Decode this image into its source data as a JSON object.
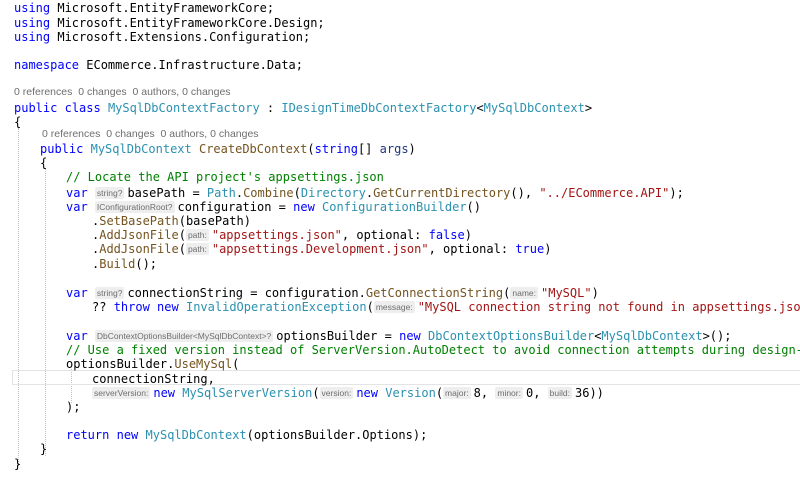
{
  "editor": {
    "language": "csharp",
    "colors": {
      "keyword": "#0000ff",
      "type": "#2b91af",
      "method": "#74531f",
      "string": "#a31515",
      "comment": "#008000",
      "parameter": "#1f377f",
      "plain": "#000000",
      "codelens": "#6e6e6e",
      "hint_text": "#6e6e6e",
      "hint_background": "#eeeeee"
    },
    "lines": [
      {
        "kind": "code",
        "tokens": [
          {
            "t": "using",
            "c": "kw"
          },
          {
            "t": " Microsoft.EntityFrameworkCore;",
            "c": "pl"
          }
        ]
      },
      {
        "kind": "code",
        "tokens": [
          {
            "t": "using",
            "c": "kw"
          },
          {
            "t": " Microsoft.EntityFrameworkCore.Design;",
            "c": "pl"
          }
        ]
      },
      {
        "kind": "code",
        "tokens": [
          {
            "t": "using",
            "c": "kw"
          },
          {
            "t": " Microsoft.Extensions.Configuration;",
            "c": "pl"
          }
        ]
      },
      {
        "kind": "blank",
        "tokens": []
      },
      {
        "kind": "code",
        "tokens": [
          {
            "t": "namespace",
            "c": "kw"
          },
          {
            "t": " ECommerce.Infrastructure.Data;",
            "c": "pl"
          }
        ]
      },
      {
        "kind": "blank",
        "tokens": []
      },
      {
        "kind": "lens",
        "tokens": [
          {
            "t": "0 references  0 changes  0 authors, 0 changes",
            "c": "lens"
          }
        ]
      },
      {
        "kind": "code",
        "tokens": [
          {
            "t": "public",
            "c": "kw"
          },
          {
            "t": " ",
            "c": "pl"
          },
          {
            "t": "class",
            "c": "kw"
          },
          {
            "t": " ",
            "c": "pl"
          },
          {
            "t": "MySqlDbContextFactory",
            "c": "ty"
          },
          {
            "t": " : ",
            "c": "pl"
          },
          {
            "t": "IDesignTimeDbContextFactory",
            "c": "ty"
          },
          {
            "t": "<",
            "c": "pl"
          },
          {
            "t": "MySqlDbContext",
            "c": "ty"
          },
          {
            "t": ">",
            "c": "pl"
          }
        ]
      },
      {
        "kind": "code",
        "tokens": [
          {
            "t": "{",
            "c": "pl"
          }
        ]
      },
      {
        "kind": "lens",
        "tokens": [
          {
            "t": "0 references  0 changes  0 authors, 0 changes",
            "c": "lens"
          }
        ]
      },
      {
        "kind": "code",
        "tokens": [
          {
            "t": "public",
            "c": "kw"
          },
          {
            "t": " ",
            "c": "pl"
          },
          {
            "t": "MySqlDbContext",
            "c": "ty"
          },
          {
            "t": " ",
            "c": "pl"
          },
          {
            "t": "CreateDbContext",
            "c": "mt"
          },
          {
            "t": "(",
            "c": "pl"
          },
          {
            "t": "string",
            "c": "kw"
          },
          {
            "t": "[] ",
            "c": "pl"
          },
          {
            "t": "args",
            "c": "pr"
          },
          {
            "t": ")",
            "c": "pl"
          }
        ]
      },
      {
        "kind": "code",
        "tokens": [
          {
            "t": "{",
            "c": "pl"
          }
        ]
      },
      {
        "kind": "code",
        "tokens": [
          {
            "t": "// Locate the API project's appsettings.json",
            "c": "cm"
          }
        ]
      },
      {
        "kind": "code",
        "tokens": [
          {
            "t": "var",
            "c": "kw"
          },
          {
            "t": " ",
            "c": "pl"
          },
          {
            "t": "string?",
            "c": "hint"
          },
          {
            "t": "basePath = ",
            "c": "pl"
          },
          {
            "t": "Path",
            "c": "ty"
          },
          {
            "t": ".",
            "c": "pl"
          },
          {
            "t": "Combine",
            "c": "mt"
          },
          {
            "t": "(",
            "c": "pl"
          },
          {
            "t": "Directory",
            "c": "ty"
          },
          {
            "t": ".",
            "c": "pl"
          },
          {
            "t": "GetCurrentDirectory",
            "c": "mt"
          },
          {
            "t": "(), ",
            "c": "pl"
          },
          {
            "t": "\"../ECommerce.API\"",
            "c": "st"
          },
          {
            "t": ");",
            "c": "pl"
          }
        ]
      },
      {
        "kind": "code",
        "tokens": [
          {
            "t": "var",
            "c": "kw"
          },
          {
            "t": " ",
            "c": "pl"
          },
          {
            "t": "IConfigurationRoot?",
            "c": "hint"
          },
          {
            "t": "configuration = ",
            "c": "pl"
          },
          {
            "t": "new",
            "c": "kw"
          },
          {
            "t": " ",
            "c": "pl"
          },
          {
            "t": "ConfigurationBuilder",
            "c": "ty"
          },
          {
            "t": "()",
            "c": "pl"
          }
        ]
      },
      {
        "kind": "code",
        "tokens": [
          {
            "t": ".",
            "c": "pl"
          },
          {
            "t": "SetBasePath",
            "c": "mt"
          },
          {
            "t": "(basePath)",
            "c": "pl"
          }
        ]
      },
      {
        "kind": "code",
        "tokens": [
          {
            "t": ".",
            "c": "pl"
          },
          {
            "t": "AddJsonFile",
            "c": "mt"
          },
          {
            "t": "(",
            "c": "pl"
          },
          {
            "t": "path:",
            "c": "hint"
          },
          {
            "t": "\"appsettings.json\"",
            "c": "st"
          },
          {
            "t": ", optional: ",
            "c": "pl"
          },
          {
            "t": "false",
            "c": "kw"
          },
          {
            "t": ")",
            "c": "pl"
          }
        ]
      },
      {
        "kind": "code",
        "tokens": [
          {
            "t": ".",
            "c": "pl"
          },
          {
            "t": "AddJsonFile",
            "c": "mt"
          },
          {
            "t": "(",
            "c": "pl"
          },
          {
            "t": "path:",
            "c": "hint"
          },
          {
            "t": "\"appsettings.Development.json\"",
            "c": "st"
          },
          {
            "t": ", optional: ",
            "c": "pl"
          },
          {
            "t": "true",
            "c": "kw"
          },
          {
            "t": ")",
            "c": "pl"
          }
        ]
      },
      {
        "kind": "code",
        "tokens": [
          {
            "t": ".",
            "c": "pl"
          },
          {
            "t": "Build",
            "c": "mt"
          },
          {
            "t": "();",
            "c": "pl"
          }
        ]
      },
      {
        "kind": "blank",
        "tokens": []
      },
      {
        "kind": "code",
        "tokens": [
          {
            "t": "var",
            "c": "kw"
          },
          {
            "t": " ",
            "c": "pl"
          },
          {
            "t": "string?",
            "c": "hint"
          },
          {
            "t": "connectionString = configuration.",
            "c": "pl"
          },
          {
            "t": "GetConnectionString",
            "c": "mt"
          },
          {
            "t": "(",
            "c": "pl"
          },
          {
            "t": "name:",
            "c": "hint"
          },
          {
            "t": "\"MySQL\"",
            "c": "st"
          },
          {
            "t": ")",
            "c": "pl"
          }
        ]
      },
      {
        "kind": "code",
        "tokens": [
          {
            "t": "?? ",
            "c": "pl"
          },
          {
            "t": "throw",
            "c": "kw"
          },
          {
            "t": " ",
            "c": "pl"
          },
          {
            "t": "new",
            "c": "kw"
          },
          {
            "t": " ",
            "c": "pl"
          },
          {
            "t": "InvalidOperationException",
            "c": "ty"
          },
          {
            "t": "(",
            "c": "pl"
          },
          {
            "t": "message:",
            "c": "hint"
          },
          {
            "t": "\"MySQL connection string not found in appsettings.json\"",
            "c": "st"
          },
          {
            "t": ");",
            "c": "pl"
          }
        ]
      },
      {
        "kind": "blank",
        "tokens": []
      },
      {
        "kind": "code",
        "tokens": [
          {
            "t": "var",
            "c": "kw"
          },
          {
            "t": " ",
            "c": "pl"
          },
          {
            "t": "DbContextOptionsBuilder<MySqlDbContext>?",
            "c": "hint"
          },
          {
            "t": "optionsBuilder = ",
            "c": "pl"
          },
          {
            "t": "new",
            "c": "kw"
          },
          {
            "t": " ",
            "c": "pl"
          },
          {
            "t": "DbContextOptionsBuilder",
            "c": "ty"
          },
          {
            "t": "<",
            "c": "pl"
          },
          {
            "t": "MySqlDbContext",
            "c": "ty"
          },
          {
            "t": ">();",
            "c": "pl"
          }
        ]
      },
      {
        "kind": "code",
        "tokens": [
          {
            "t": "// Use a fixed version instead of ServerVersion.AutoDetect to avoid connection attempts during design-time",
            "c": "cm"
          }
        ]
      },
      {
        "kind": "code",
        "tokens": [
          {
            "t": "optionsBuilder.",
            "c": "pl"
          },
          {
            "t": "UseMySql",
            "c": "mt"
          },
          {
            "t": "(",
            "c": "pl"
          }
        ]
      },
      {
        "kind": "code",
        "tokens": [
          {
            "t": "connectionString,",
            "c": "pl"
          }
        ]
      },
      {
        "kind": "code",
        "tokens": [
          {
            "t": "serverVersion:",
            "c": "hint"
          },
          {
            "t": "new",
            "c": "kw"
          },
          {
            "t": " ",
            "c": "pl"
          },
          {
            "t": "MySqlServerVersion",
            "c": "ty"
          },
          {
            "t": "(",
            "c": "pl"
          },
          {
            "t": "version:",
            "c": "hint"
          },
          {
            "t": "new",
            "c": "kw"
          },
          {
            "t": " ",
            "c": "pl"
          },
          {
            "t": "Version",
            "c": "ty"
          },
          {
            "t": "(",
            "c": "pl"
          },
          {
            "t": "major:",
            "c": "hint"
          },
          {
            "t": "8",
            "c": "nu"
          },
          {
            "t": ", ",
            "c": "pl"
          },
          {
            "t": "minor:",
            "c": "hint"
          },
          {
            "t": "0",
            "c": "nu"
          },
          {
            "t": ", ",
            "c": "pl"
          },
          {
            "t": "build:",
            "c": "hint"
          },
          {
            "t": "36",
            "c": "nu"
          },
          {
            "t": "))",
            "c": "pl"
          }
        ]
      },
      {
        "kind": "code",
        "tokens": [
          {
            "t": ");",
            "c": "pl"
          }
        ]
      },
      {
        "kind": "blank",
        "tokens": []
      },
      {
        "kind": "code",
        "tokens": [
          {
            "t": "return",
            "c": "kw"
          },
          {
            "t": " ",
            "c": "pl"
          },
          {
            "t": "new",
            "c": "kw"
          },
          {
            "t": " ",
            "c": "pl"
          },
          {
            "t": "MySqlDbContext",
            "c": "ty"
          },
          {
            "t": "(optionsBuilder.Options);",
            "c": "pl"
          }
        ]
      },
      {
        "kind": "code",
        "tokens": [
          {
            "t": "}",
            "c": "pl"
          }
        ]
      },
      {
        "kind": "code",
        "tokens": [
          {
            "t": "}",
            "c": "pl"
          }
        ]
      }
    ]
  }
}
